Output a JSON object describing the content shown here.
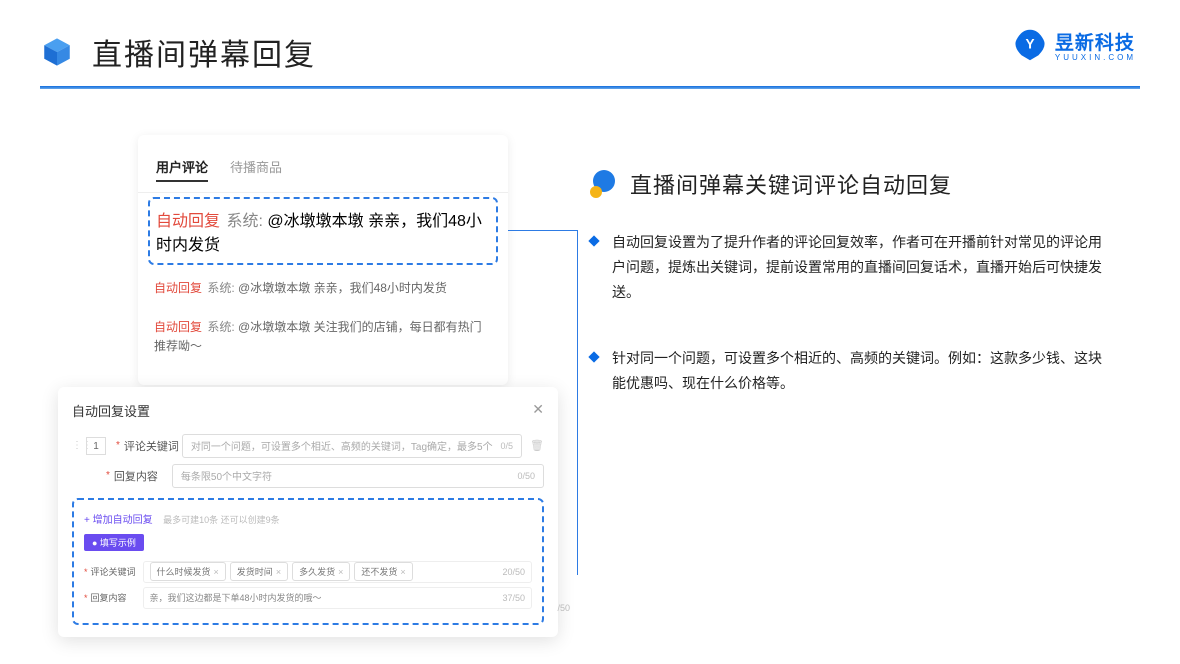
{
  "header": {
    "title": "直播间弹幕回复",
    "brand_name": "昱新科技",
    "brand_sub": "YUUXIN.COM"
  },
  "tabs": {
    "user_comments": "用户评论",
    "pending_goods": "待播商品"
  },
  "comments": {
    "tag": "自动回复",
    "sys_prefix": "系统:",
    "row1": "@冰墩墩本墩 亲亲，我们48小时内发货",
    "row2": "@冰墩墩本墩 亲亲，我们48小时内发货",
    "row3": "@冰墩墩本墩 关注我们的店铺，每日都有热门推荐呦～"
  },
  "settings": {
    "title": "自动回复设置",
    "idx": "1",
    "keyword_label": "评论关键词",
    "keyword_placeholder": "对同一个问题，可设置多个相近、高频的关键词，Tag确定，最多5个",
    "keyword_counter": "0/5",
    "content_label": "回复内容",
    "content_placeholder": "每条限50个中文字符",
    "content_counter": "0/50",
    "add_link": "+ 增加自动回复",
    "add_desc": "最多可建10条 还可以创建9条",
    "example_badge": "● 填写示例",
    "ex_kw_label": "评论关键词",
    "ex_tags": [
      "什么时候发货",
      "发货时间",
      "多久发货",
      "还不发货"
    ],
    "ex_kw_counter": "20/50",
    "ex_content_label": "回复内容",
    "ex_content_value": "亲，我们这边都是下单48小时内发货的哦～",
    "ex_content_counter": "37/50",
    "outer_counter": "/50"
  },
  "right": {
    "section_title": "直播间弹幕关键词评论自动回复",
    "bullet1": "自动回复设置为了提升作者的评论回复效率，作者可在开播前针对常见的评论用户问题，提炼出关键词，提前设置常用的直播间回复话术，直播开始后可快捷发送。",
    "bullet2": "针对同一个问题，可设置多个相近的、高频的关键词。例如：这款多少钱、这块能优惠吗、现在什么价格等。"
  }
}
